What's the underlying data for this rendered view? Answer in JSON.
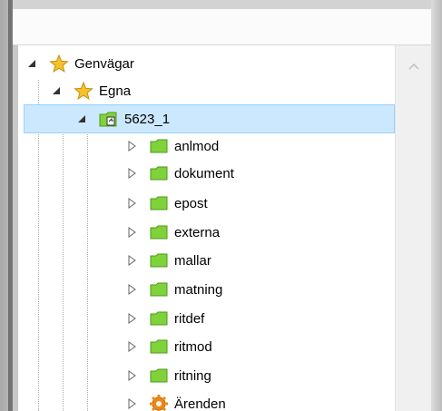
{
  "tree": {
    "nodes": [
      {
        "label": "Genvägar",
        "icon": "star-icon",
        "expanded": true,
        "depth": 0
      },
      {
        "label": "Egna",
        "icon": "star-icon",
        "expanded": true,
        "depth": 1
      },
      {
        "label": "5623_1",
        "icon": "project-icon",
        "expanded": true,
        "depth": 2,
        "selected": true
      },
      {
        "label": "anlmod",
        "icon": "folder-icon",
        "expanded": false,
        "depth": 3
      },
      {
        "label": "dokument",
        "icon": "folder-icon",
        "expanded": false,
        "depth": 3
      },
      {
        "label": "epost",
        "icon": "folder-icon",
        "expanded": false,
        "depth": 3
      },
      {
        "label": "externa",
        "icon": "folder-icon",
        "expanded": false,
        "depth": 3
      },
      {
        "label": "mallar",
        "icon": "folder-icon",
        "expanded": false,
        "depth": 3
      },
      {
        "label": "matning",
        "icon": "folder-icon",
        "expanded": false,
        "depth": 3
      },
      {
        "label": "ritdef",
        "icon": "folder-icon",
        "expanded": false,
        "depth": 3
      },
      {
        "label": "ritmod",
        "icon": "folder-icon",
        "expanded": false,
        "depth": 3
      },
      {
        "label": "ritning",
        "icon": "folder-icon",
        "expanded": false,
        "depth": 3
      },
      {
        "label": "Ärenden",
        "icon": "gear-icon",
        "expanded": false,
        "depth": 3
      }
    ]
  },
  "colors": {
    "selection_bg": "#cce8ff",
    "selection_border": "#99d1ff",
    "folder_green": "#7fd23a",
    "star_gold": "#f5c02c",
    "gear_orange": "#e8891a"
  },
  "scrollbar": {
    "up_icon": "chevron-up-icon"
  }
}
